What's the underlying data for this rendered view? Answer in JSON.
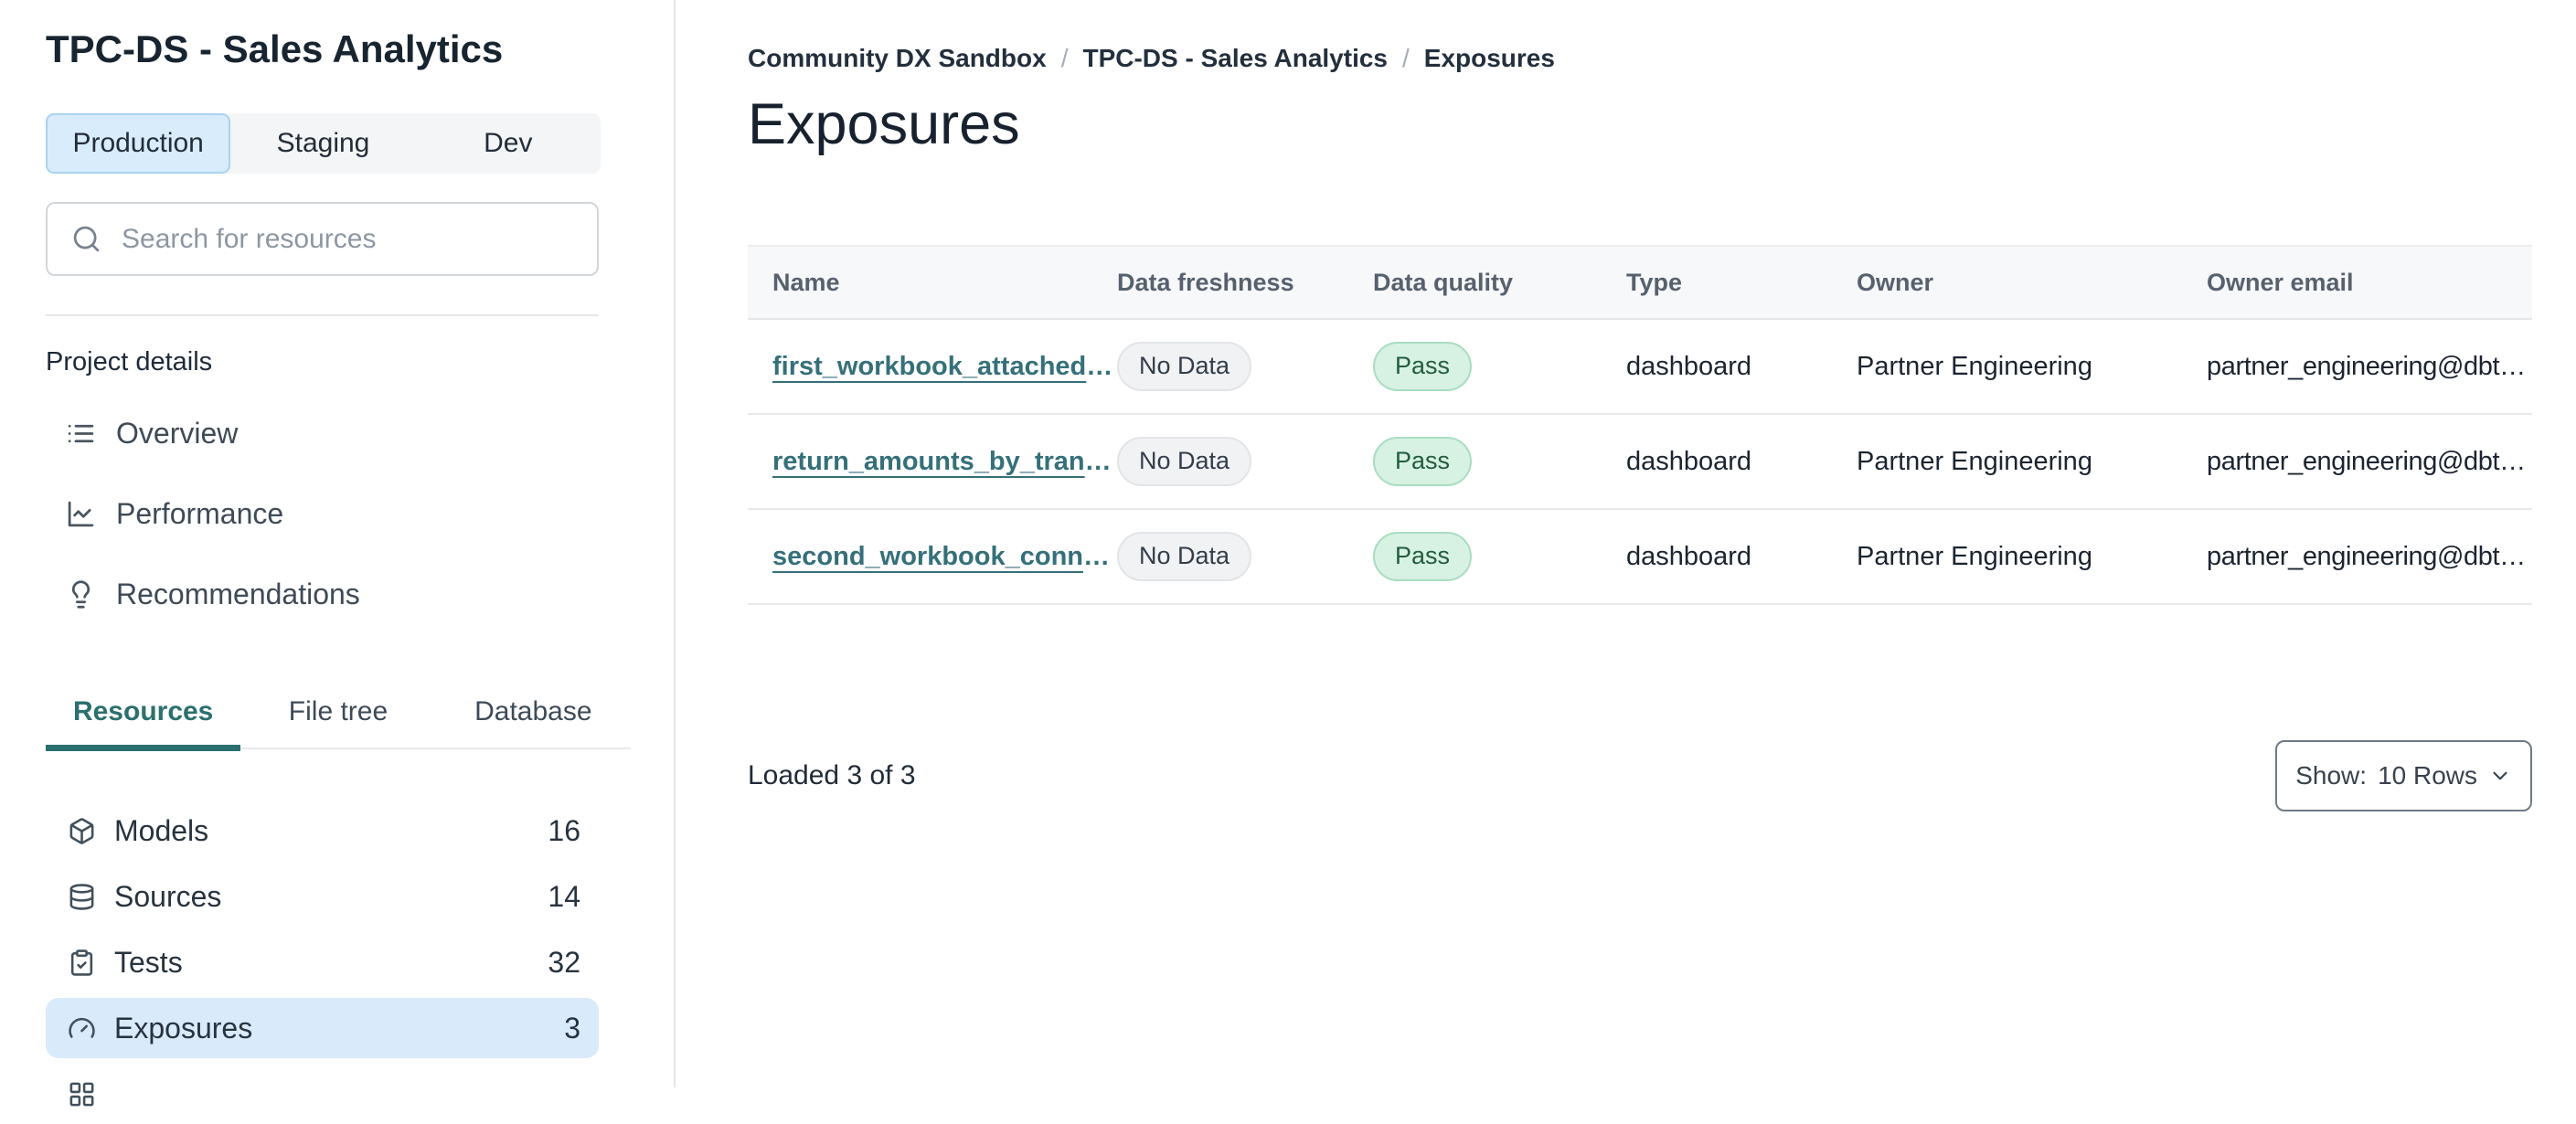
{
  "colors": {
    "teal": "#2a706e",
    "link": "#35707a",
    "selected-blue-bg": "#d9ecfb",
    "selected-blue-border": "#a9d3f2",
    "row-highlight": "#d9eafb",
    "badge-gray-bg": "#f1f2f4",
    "badge-gray-border": "#e2e4e8",
    "badge-gray-text": "#333e4a",
    "badge-green-bg": "#d7f1e2",
    "badge-green-border": "#a9ddc3",
    "badge-green-text": "#235c3f",
    "header-bg": "#f7f8fa",
    "border": "#e4e6e9",
    "text-dark": "#1c2835",
    "text-nav": "#3e4a57",
    "text-muted": "#57616e"
  },
  "sidebar": {
    "project_title": "TPC-DS - Sales Analytics",
    "env_tabs": [
      {
        "label": "Production",
        "active": true
      },
      {
        "label": "Staging",
        "active": false
      },
      {
        "label": "Dev",
        "active": false
      }
    ],
    "search": {
      "placeholder": "Search for resources"
    },
    "section_label": "Project details",
    "nav_items": [
      {
        "icon": "list-icon",
        "label": "Overview"
      },
      {
        "icon": "chart-line-icon",
        "label": "Performance"
      },
      {
        "icon": "lightbulb-icon",
        "label": "Recommendations"
      }
    ],
    "view_tabs": [
      {
        "label": "Resources",
        "active": true
      },
      {
        "label": "File tree",
        "active": false
      },
      {
        "label": "Database",
        "active": false
      }
    ],
    "resources": [
      {
        "icon": "cube-icon",
        "label": "Models",
        "count": "16",
        "active": false
      },
      {
        "icon": "database-icon",
        "label": "Sources",
        "count": "14",
        "active": false
      },
      {
        "icon": "clipboard-check-icon",
        "label": "Tests",
        "count": "32",
        "active": false
      },
      {
        "icon": "gauge-icon",
        "label": "Exposures",
        "count": "3",
        "active": true
      }
    ]
  },
  "main": {
    "breadcrumb": {
      "items": [
        "Community DX Sandbox",
        "TPC-DS - Sales Analytics",
        "Exposures"
      ],
      "separator": "/"
    },
    "page_title": "Exposures",
    "table": {
      "ellipsis": "…",
      "columns": [
        "Name",
        "Data freshness",
        "Data quality",
        "Type",
        "Owner",
        "Owner email"
      ],
      "rows": [
        {
          "name": "first_workbook_attached",
          "freshness": "No Data",
          "quality": "Pass",
          "type": "dashboard",
          "owner": "Partner Engineering",
          "owner_email": "partner_engineering@dbt"
        },
        {
          "name": "return_amounts_by_tran",
          "freshness": "No Data",
          "quality": "Pass",
          "type": "dashboard",
          "owner": "Partner Engineering",
          "owner_email": "partner_engineering@dbt"
        },
        {
          "name": "second_workbook_conn",
          "freshness": "No Data",
          "quality": "Pass",
          "type": "dashboard",
          "owner": "Partner Engineering",
          "owner_email": "partner_engineering@dbt"
        }
      ]
    },
    "footer": {
      "loaded_text": "Loaded 3 of 3",
      "show_label": "Show:",
      "show_value": "10 Rows"
    }
  }
}
